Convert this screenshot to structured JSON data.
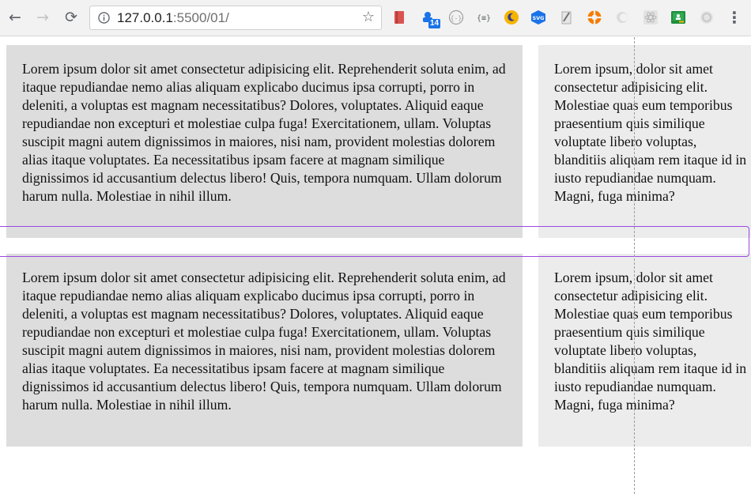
{
  "browser": {
    "url_host": "127.0.0.1",
    "url_rest": ":5500/01/",
    "extensions": [
      {
        "name": "book-icon",
        "color": "#d9534f"
      },
      {
        "name": "extension-badge-icon",
        "badge": "14",
        "color": "#1a73e8"
      },
      {
        "name": "json-viewer-icon",
        "color": "#9e9e9e"
      },
      {
        "name": "braces-icon",
        "color": "#5f6368"
      },
      {
        "name": "moon-icon",
        "color": "#f5b400"
      },
      {
        "name": "svg-icon",
        "color": "#1a73e8"
      },
      {
        "name": "pen-icon",
        "color": "#6f6f6f"
      },
      {
        "name": "lifebuoy-icon",
        "color": "#f57c00"
      },
      {
        "name": "faded-extension-icon",
        "color": "#d0d0d0"
      },
      {
        "name": "react-icon",
        "color": "#cfcfcf"
      },
      {
        "name": "classroom-icon",
        "color": "#1e8e3e"
      },
      {
        "name": "gray-circle-icon",
        "color": "#d0d0d0"
      }
    ]
  },
  "content": {
    "long_text": "Lorem ipsum dolor sit amet consectetur adipisicing elit. Reprehenderit soluta enim, ad itaque repudiandae nemo alias aliquam explicabo ducimus ipsa corrupti, porro in deleniti, a voluptas est magnam necessitatibus? Dolores, voluptates. Aliquid eaque repudiandae non excepturi et molestiae culpa fuga! Exercitationem, ullam. Voluptas suscipit magni autem dignissimos in maiores, nisi nam, provident molestias dolorem alias itaque voluptates. Ea necessitatibus ipsam facere at magnam similique dignissimos id accusantium delectus libero! Quis, tempora numquam. Ullam dolorum harum nulla. Molestiae in nihil illum.",
    "short_text": "Lorem ipsum, dolor sit amet consectetur adipisicing elit. Molestiae quas eum temporibus praesentium quis similique voluptate libero voluptas, blanditiis aliquam rem itaque id in iusto repudiandae numquam. Magni, fuga minima?"
  }
}
